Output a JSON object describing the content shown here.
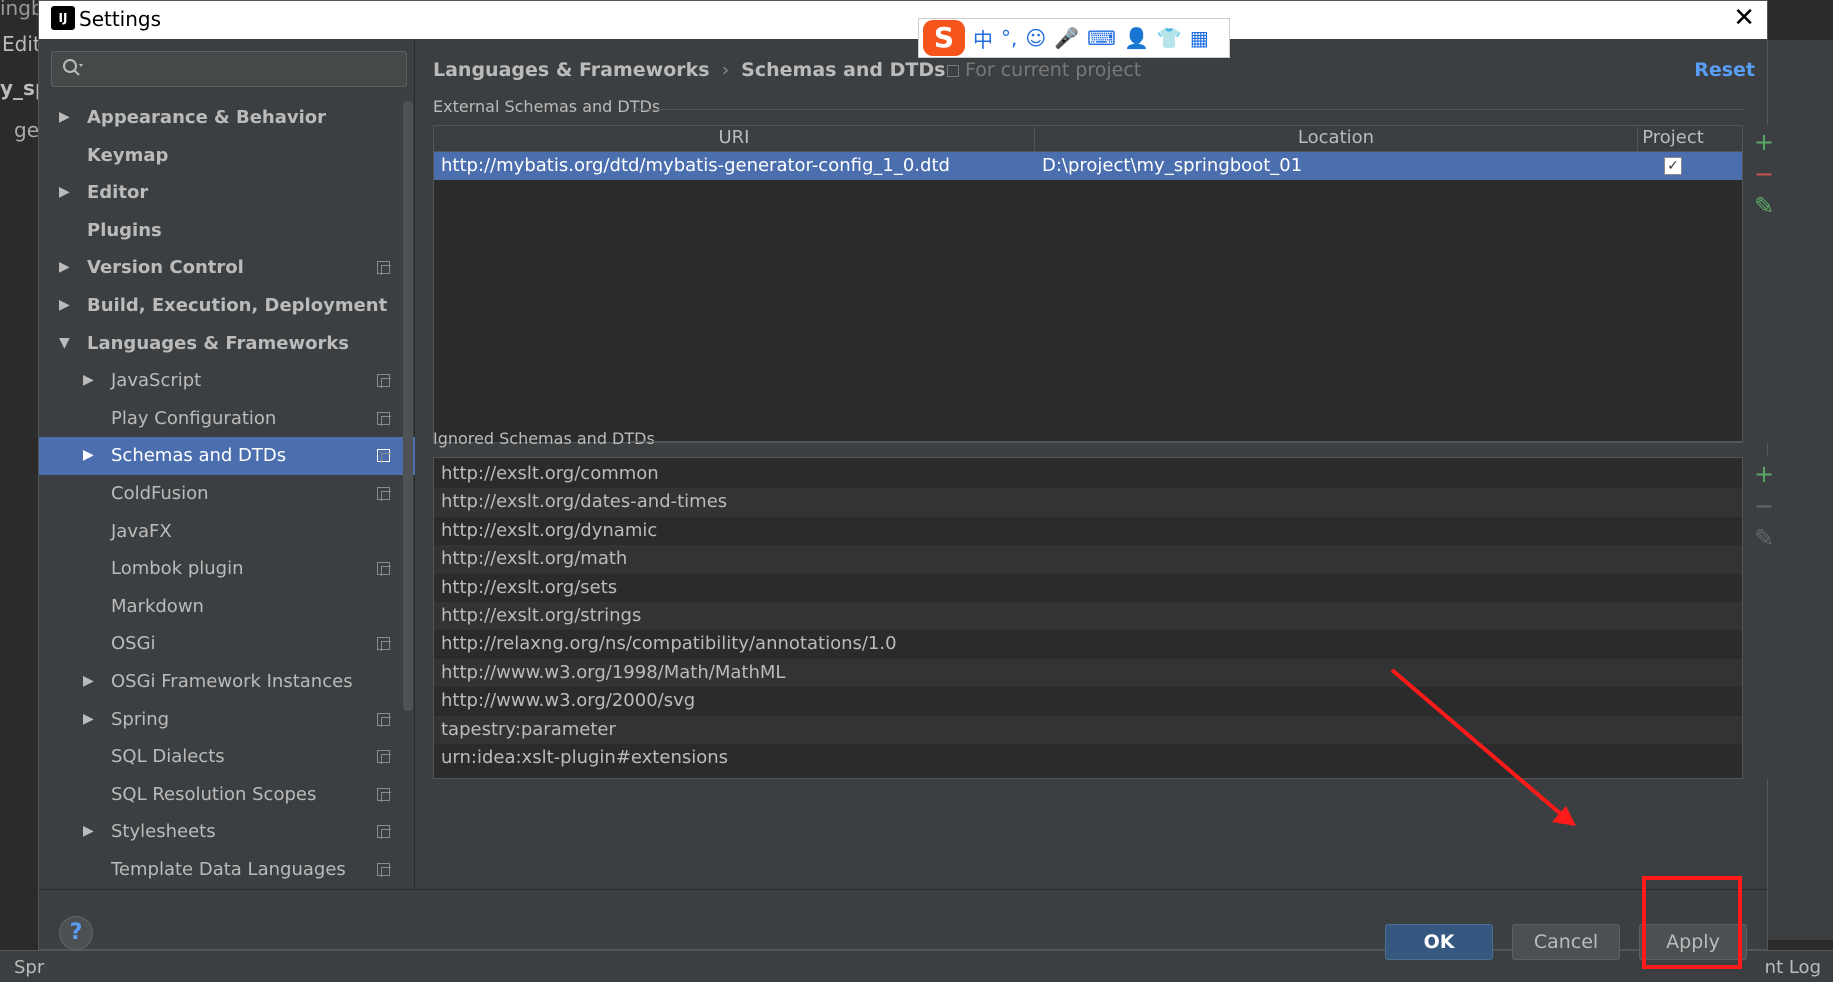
{
  "background": {
    "left_texts": [
      "ingb",
      "Edit",
      "y_sp",
      "ge"
    ],
    "bottom_left": "Spr",
    "bottom_right": "nt Log"
  },
  "dialog": {
    "title": "Settings",
    "close_glyph": "✕"
  },
  "ime_toolbar": {
    "logo": "S",
    "items": [
      "中",
      "°,",
      "☺",
      "🎤",
      "⌨",
      "👤",
      "👕",
      "▦"
    ]
  },
  "sidebar": {
    "search_placeholder": "",
    "items": [
      {
        "label": "Appearance & Behavior",
        "level": 0,
        "arrow": "▶",
        "bold": true,
        "project": false
      },
      {
        "label": "Keymap",
        "level": 0,
        "arrow": "",
        "bold": true,
        "project": false
      },
      {
        "label": "Editor",
        "level": 0,
        "arrow": "▶",
        "bold": true,
        "project": false
      },
      {
        "label": "Plugins",
        "level": 0,
        "arrow": "",
        "bold": true,
        "project": false
      },
      {
        "label": "Version Control",
        "level": 0,
        "arrow": "▶",
        "bold": true,
        "project": true
      },
      {
        "label": "Build, Execution, Deployment",
        "level": 0,
        "arrow": "▶",
        "bold": true,
        "project": false
      },
      {
        "label": "Languages & Frameworks",
        "level": 0,
        "arrow": "▼",
        "bold": true,
        "project": false
      },
      {
        "label": "JavaScript",
        "level": 1,
        "arrow": "▶",
        "bold": false,
        "project": true
      },
      {
        "label": "Play Configuration",
        "level": 1,
        "arrow": "",
        "bold": false,
        "project": true
      },
      {
        "label": "Schemas and DTDs",
        "level": 1,
        "arrow": "▶",
        "bold": false,
        "project": true,
        "selected": true
      },
      {
        "label": "ColdFusion",
        "level": 1,
        "arrow": "",
        "bold": false,
        "project": true
      },
      {
        "label": "JavaFX",
        "level": 1,
        "arrow": "",
        "bold": false,
        "project": false
      },
      {
        "label": "Lombok plugin",
        "level": 1,
        "arrow": "",
        "bold": false,
        "project": true
      },
      {
        "label": "Markdown",
        "level": 1,
        "arrow": "",
        "bold": false,
        "project": false
      },
      {
        "label": "OSGi",
        "level": 1,
        "arrow": "",
        "bold": false,
        "project": true
      },
      {
        "label": "OSGi Framework Instances",
        "level": 1,
        "arrow": "▶",
        "bold": false,
        "project": false
      },
      {
        "label": "Spring",
        "level": 1,
        "arrow": "▶",
        "bold": false,
        "project": true
      },
      {
        "label": "SQL Dialects",
        "level": 1,
        "arrow": "",
        "bold": false,
        "project": true
      },
      {
        "label": "SQL Resolution Scopes",
        "level": 1,
        "arrow": "",
        "bold": false,
        "project": true
      },
      {
        "label": "Stylesheets",
        "level": 1,
        "arrow": "▶",
        "bold": false,
        "project": true
      },
      {
        "label": "Template Data Languages",
        "level": 1,
        "arrow": "",
        "bold": false,
        "project": true
      }
    ]
  },
  "content": {
    "breadcrumb": [
      "Languages & Frameworks",
      "Schemas and DTDs"
    ],
    "breadcrumb_sep": "›",
    "for_project": "For current project",
    "reset": "Reset",
    "external": {
      "label": "External Schemas and DTDs",
      "columns": [
        "URI",
        "Location",
        "Project"
      ],
      "rows": [
        {
          "uri": "http://mybatis.org/dtd/mybatis-generator-config_1_0.dtd",
          "location": "D:\\project\\my_springboot_01",
          "project": "✓"
        }
      ]
    },
    "ignored": {
      "label": "Ignored Schemas and DTDs",
      "rows": [
        "http://exslt.org/common",
        "http://exslt.org/dates-and-times",
        "http://exslt.org/dynamic",
        "http://exslt.org/math",
        "http://exslt.org/sets",
        "http://exslt.org/strings",
        "http://relaxng.org/ns/compatibility/annotations/1.0",
        "http://www.w3.org/1998/Math/MathML",
        "http://www.w3.org/2000/svg",
        "tapestry:parameter",
        "urn:idea:xslt-plugin#extensions"
      ]
    },
    "tool_glyphs": {
      "add": "+",
      "remove": "−",
      "edit": "✎"
    }
  },
  "footer": {
    "help": "?",
    "ok": "OK",
    "cancel": "Cancel",
    "apply": "Apply"
  },
  "annotation": {
    "color": "#ff1a1a"
  }
}
